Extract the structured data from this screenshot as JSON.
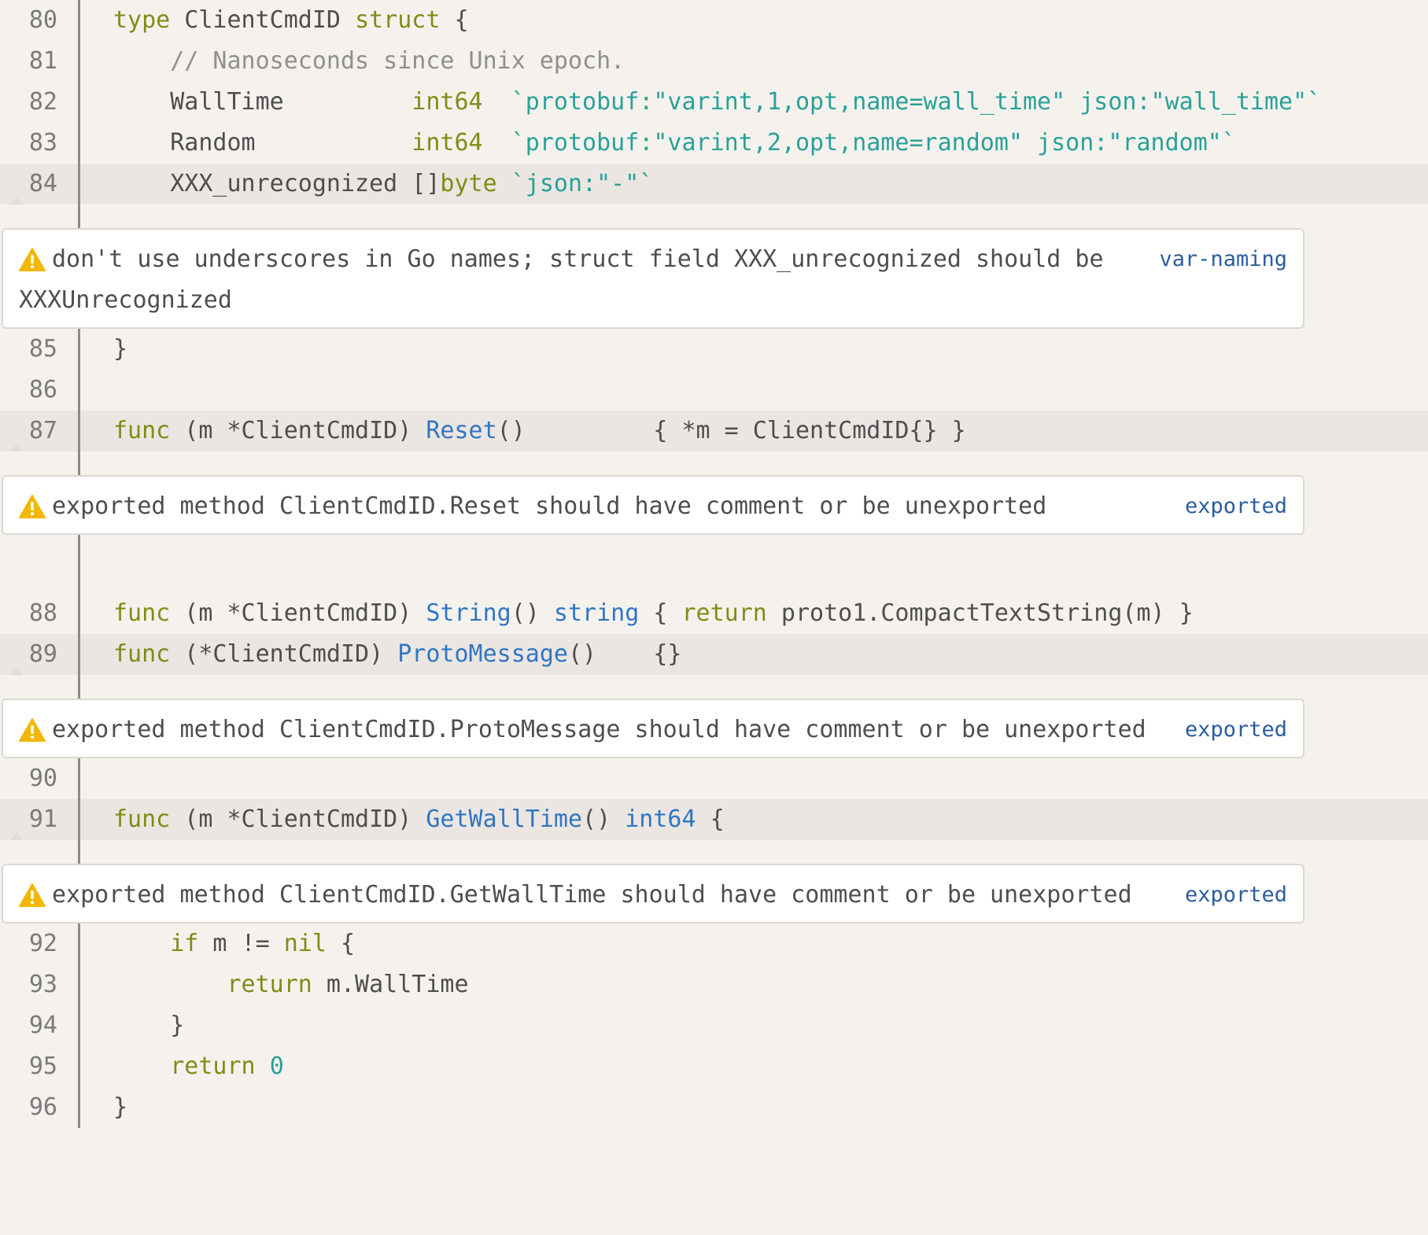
{
  "lines": [
    {
      "n": "80",
      "t": [
        [
          "kw",
          "type"
        ],
        [
          "p",
          " ClientCmdID "
        ],
        [
          "kw",
          "struct"
        ],
        [
          "p",
          " {"
        ]
      ]
    },
    {
      "n": "81",
      "t": [
        [
          "p",
          "    "
        ],
        [
          "cm",
          "// Nanoseconds since Unix epoch."
        ]
      ]
    },
    {
      "n": "82",
      "t": [
        [
          "p",
          "    WallTime         "
        ],
        [
          "kw",
          "int64"
        ],
        [
          "p",
          "  "
        ],
        [
          "str",
          "`protobuf:\"varint,1,opt,name=wall_time\" json:\"wall_time\"`"
        ]
      ]
    },
    {
      "n": "83",
      "t": [
        [
          "p",
          "    Random           "
        ],
        [
          "kw",
          "int64"
        ],
        [
          "p",
          "  "
        ],
        [
          "str",
          "`protobuf:\"varint,2,opt,name=random\" json:\"random\"`"
        ]
      ]
    },
    {
      "n": "84",
      "t": [
        [
          "p",
          "    XXX_unrecognized []"
        ],
        [
          "kw",
          "byte"
        ],
        [
          "p",
          " "
        ],
        [
          "str",
          "`json:\"-\"`"
        ]
      ]
    },
    {
      "n": "85",
      "t": [
        [
          "p",
          "}"
        ]
      ]
    },
    {
      "n": "86",
      "t": []
    },
    {
      "n": "87",
      "t": [
        [
          "kw",
          "func"
        ],
        [
          "p",
          " (m *ClientCmdID) "
        ],
        [
          "fn",
          "Reset"
        ],
        [
          "p",
          "()         { *m = ClientCmdID{} }"
        ]
      ]
    },
    {
      "n": "88",
      "t": [
        [
          "kw",
          "func"
        ],
        [
          "p",
          " (m *ClientCmdID) "
        ],
        [
          "fn",
          "String"
        ],
        [
          "p",
          "() "
        ],
        [
          "fn",
          "string"
        ],
        [
          "p",
          " { "
        ],
        [
          "kw",
          "return"
        ],
        [
          "p",
          " proto1.CompactTextString(m) }"
        ]
      ]
    },
    {
      "n": "89",
      "t": [
        [
          "kw",
          "func"
        ],
        [
          "p",
          " (*ClientCmdID) "
        ],
        [
          "fn",
          "ProtoMessage"
        ],
        [
          "p",
          "()    {}"
        ]
      ]
    },
    {
      "n": "90",
      "t": []
    },
    {
      "n": "91",
      "t": [
        [
          "kw",
          "func"
        ],
        [
          "p",
          " (m *ClientCmdID) "
        ],
        [
          "fn",
          "GetWallTime"
        ],
        [
          "p",
          "() "
        ],
        [
          "fn",
          "int64"
        ],
        [
          "p",
          " {"
        ]
      ]
    },
    {
      "n": "92",
      "t": [
        [
          "p",
          "    "
        ],
        [
          "kw",
          "if"
        ],
        [
          "p",
          " m != "
        ],
        [
          "kw",
          "nil"
        ],
        [
          "p",
          " {"
        ]
      ]
    },
    {
      "n": "93",
      "t": [
        [
          "p",
          "        "
        ],
        [
          "kw",
          "return"
        ],
        [
          "p",
          " m.WallTime"
        ]
      ]
    },
    {
      "n": "94",
      "t": [
        [
          "p",
          "    }"
        ]
      ]
    },
    {
      "n": "95",
      "t": [
        [
          "p",
          "    "
        ],
        [
          "kw",
          "return"
        ],
        [
          "p",
          " "
        ],
        [
          "num",
          "0"
        ]
      ]
    },
    {
      "n": "96",
      "t": [
        [
          "p",
          "}"
        ]
      ]
    }
  ],
  "lints": [
    {
      "message": "don't use underscores in Go names; struct field XXX_unrecognized should be XXXUnrecognized",
      "rule": "var-naming"
    },
    {
      "message": "exported method ClientCmdID.Reset should have comment or be unexported",
      "rule": "exported"
    },
    {
      "message": "exported method ClientCmdID.ProtoMessage should have comment or be unexported",
      "rule": "exported"
    },
    {
      "message": "exported method ClientCmdID.GetWallTime should have comment or be unexported",
      "rule": "exported"
    }
  ],
  "colors": {
    "background": "#f5f2ee",
    "highlight": "#ebe6e2",
    "keyword": "#7f8d16",
    "function": "#3176c2",
    "string": "#2aa198",
    "comment": "#8f8f8f",
    "warning": "#f2b705",
    "rule": "#2b5d9e"
  }
}
